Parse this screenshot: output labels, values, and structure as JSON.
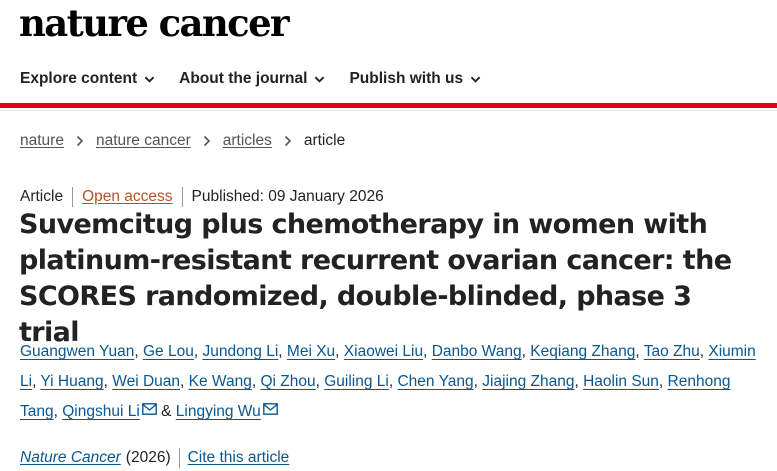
{
  "brand": {
    "name": "nature cancer"
  },
  "nav": {
    "items": [
      {
        "label": "Explore content"
      },
      {
        "label": "About the journal"
      },
      {
        "label": "Publish with us"
      }
    ]
  },
  "breadcrumb": {
    "items": [
      "nature",
      "nature cancer",
      "articles"
    ],
    "current": "article"
  },
  "meta": {
    "type": "Article",
    "access": "Open access",
    "published": "Published: 09 January 2026"
  },
  "article": {
    "title_lines": [
      "Suvemcitug plus chemotherapy in women with",
      "platinum-resistant recurrent ovarian cancer: the",
      "SCORES randomized, double-blinded, phase 3 trial"
    ]
  },
  "authors": {
    "names": [
      "Guangwen Yuan",
      "Ge Lou",
      "Jundong Li",
      "Mei Xu",
      "Xiaowei Liu",
      "Danbo Wang",
      "Keqiang Zhang",
      "Tao Zhu",
      "Xiumin Li",
      "Yi Huang",
      "Wei Duan",
      "Ke Wang",
      "Qi Zhou",
      "Guiling Li",
      "Chen Yang",
      "Jiajing Zhang",
      "Haolin Sun",
      "Renhong Tang",
      "Qingshui Li"
    ],
    "last": "Lingying Wu",
    "conjunction": "&",
    "separator": ","
  },
  "citation": {
    "journal": "Nature Cancer",
    "year": "(2026)",
    "cite_label": "Cite this article"
  },
  "colors": {
    "accent_red": "#e0001a",
    "link_blue": "#0a5790",
    "open_access": "#b5502d"
  },
  "icons": {
    "nav_chevron": "chevron-down-icon",
    "breadcrumb_separator": "chevron-right-icon",
    "email": "envelope-icon"
  }
}
